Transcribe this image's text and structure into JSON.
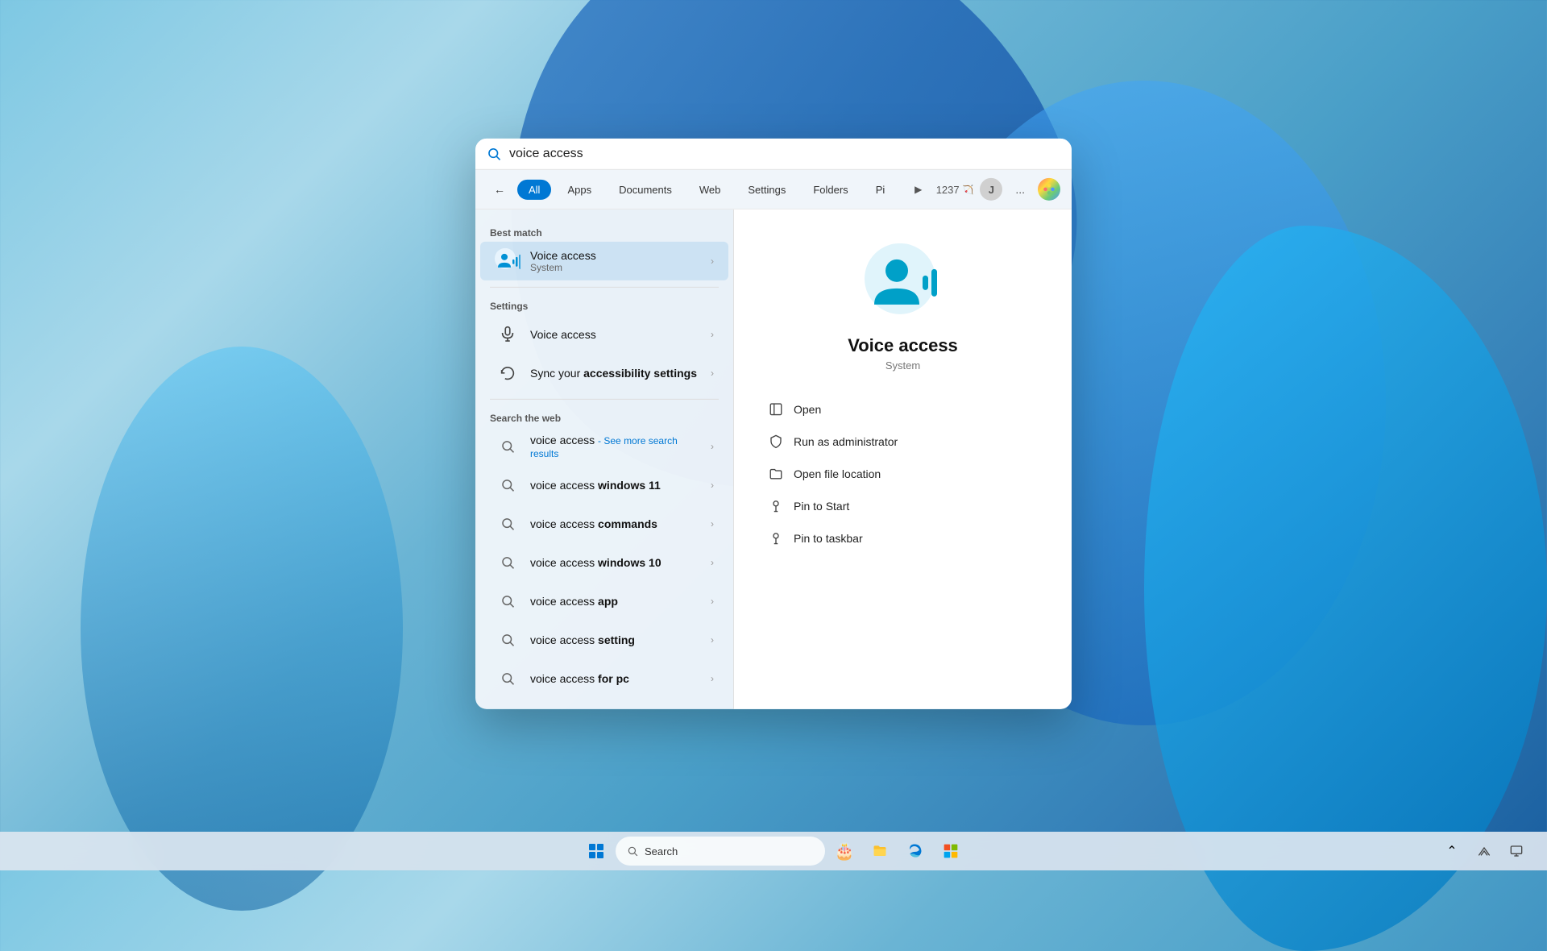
{
  "background": {
    "color": "#6ab4d4"
  },
  "taskbar": {
    "start_label": "⊞",
    "search_placeholder": "Search",
    "search_icon": "🔍",
    "icons": [
      "🔍",
      "🌐",
      "🗂️",
      "🛒"
    ],
    "right_icons": [
      "⌃",
      "🔄",
      "⬜"
    ]
  },
  "search": {
    "placeholder": "voice access",
    "input_value": "voice access"
  },
  "filter_tabs": {
    "back": "←",
    "tabs": [
      {
        "id": "all",
        "label": "All",
        "active": true
      },
      {
        "id": "apps",
        "label": "Apps"
      },
      {
        "id": "documents",
        "label": "Documents"
      },
      {
        "id": "web",
        "label": "Web"
      },
      {
        "id": "settings",
        "label": "Settings"
      },
      {
        "id": "folders",
        "label": "Folders"
      },
      {
        "id": "pi",
        "label": "Pi"
      }
    ],
    "score": "1237",
    "avatar_label": "J",
    "more_label": "..."
  },
  "left_panel": {
    "best_match_label": "Best match",
    "best_match": {
      "title": "Voice access",
      "subtitle": "System"
    },
    "settings_label": "Settings",
    "settings_items": [
      {
        "label": "Voice access"
      },
      {
        "label": "Sync your accessibility settings"
      }
    ],
    "web_label": "Search the web",
    "web_items": [
      {
        "prefix": "voice access",
        "suffix": " - See more search results"
      },
      {
        "prefix": "voice access ",
        "bold_suffix": "windows 11"
      },
      {
        "prefix": "voice access ",
        "bold_suffix": "commands"
      },
      {
        "prefix": "voice access ",
        "bold_suffix": "windows 10"
      },
      {
        "prefix": "voice access ",
        "bold_suffix": "app"
      },
      {
        "prefix": "voice access ",
        "bold_suffix": "setting"
      },
      {
        "prefix": "voice access ",
        "bold_suffix": "for pc"
      }
    ]
  },
  "right_panel": {
    "title": "Voice access",
    "subtitle": "System",
    "actions": [
      {
        "icon": "open",
        "label": "Open"
      },
      {
        "icon": "shield",
        "label": "Run as administrator"
      },
      {
        "icon": "folder",
        "label": "Open file location"
      },
      {
        "icon": "pin-start",
        "label": "Pin to Start"
      },
      {
        "icon": "pin-taskbar",
        "label": "Pin to taskbar"
      }
    ]
  }
}
